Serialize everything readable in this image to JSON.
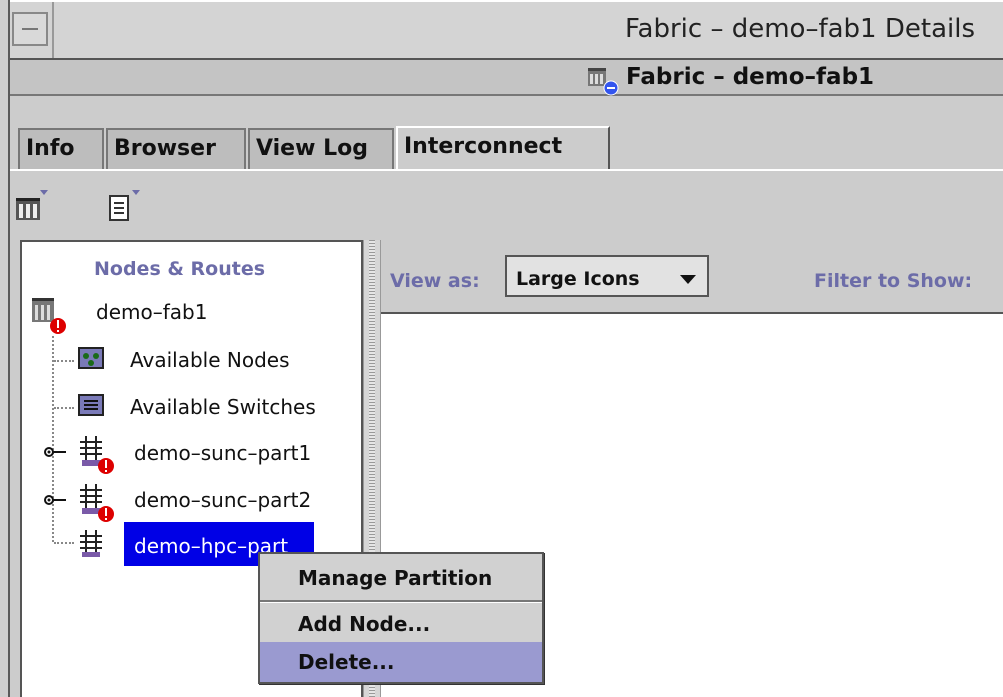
{
  "window": {
    "title": "Fabric – demo–fab1 Details",
    "header_title": "Fabric – demo–fab1"
  },
  "tabs": [
    {
      "label": "Info",
      "active": false
    },
    {
      "label": "Browser",
      "active": false
    },
    {
      "label": "View Log",
      "active": false
    },
    {
      "label": "Interconnect",
      "active": true
    }
  ],
  "toolbar": {
    "icons": [
      "fabric-menu-icon",
      "document-menu-icon"
    ]
  },
  "tree": {
    "heading": "Nodes & Routes",
    "root": {
      "label": "demo–fab1",
      "icon": "fabric-error-icon"
    },
    "items": [
      {
        "label": "Available Nodes",
        "icon": "nodes-icon"
      },
      {
        "label": "Available Switches",
        "icon": "switches-icon"
      },
      {
        "label": "demo–sunc–part1",
        "icon": "partition-error-icon"
      },
      {
        "label": "demo–sunc–part2",
        "icon": "partition-error-icon"
      },
      {
        "label": "demo–hpc–part",
        "icon": "partition-icon",
        "selected": true
      }
    ]
  },
  "view": {
    "view_as_label": "View as:",
    "view_as_value": "Large Icons",
    "filter_label": "Filter to Show:"
  },
  "context_menu": {
    "items": [
      {
        "label": "Manage Partition",
        "highlighted": false
      },
      {
        "label": "Add Node...",
        "highlighted": false
      },
      {
        "label": "Delete...",
        "highlighted": true
      }
    ]
  },
  "colors": {
    "selection": "#0000e6",
    "menu_highlight": "#9a9ad0",
    "label_blue": "#6c6ca8",
    "error_red": "#dd0000"
  }
}
